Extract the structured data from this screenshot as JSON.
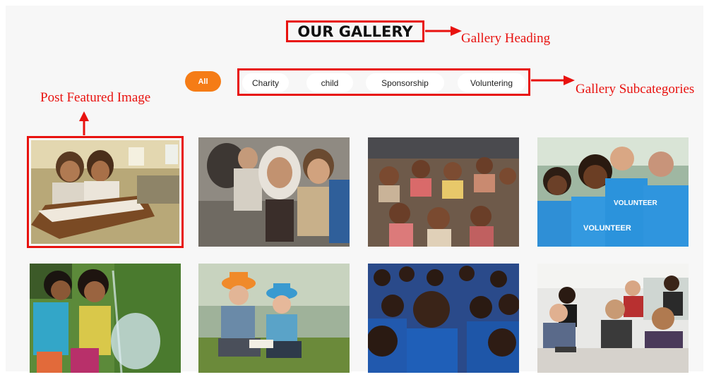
{
  "gallery": {
    "heading": "OUR GALLERY",
    "filters": {
      "active": "All",
      "items": [
        "Charity",
        "child",
        "Sponsorship",
        "Voluntering"
      ]
    },
    "images": [
      {
        "subject": "two girls writing in schoolbook at desk"
      },
      {
        "subject": "children in shawls sitting outdoors"
      },
      {
        "subject": "classroom of children clapping"
      },
      {
        "subject": "smiling volunteers in blue t-shirts",
        "caption": "VOLUNTEER"
      },
      {
        "subject": "children playing with water spray"
      },
      {
        "subject": "two boys in hats reading in field"
      },
      {
        "subject": "crowd of children in blue uniforms"
      },
      {
        "subject": "team meeting in bright office"
      }
    ]
  },
  "annotations": {
    "gallery_heading": "Gallery Heading",
    "gallery_subcategories": "Gallery Subcategories",
    "post_featured_image": "Post Featured Image"
  },
  "colors": {
    "annotation_red": "#e8120f",
    "accent_orange": "#f57c16",
    "panel_bg": "#f7f7f7"
  }
}
